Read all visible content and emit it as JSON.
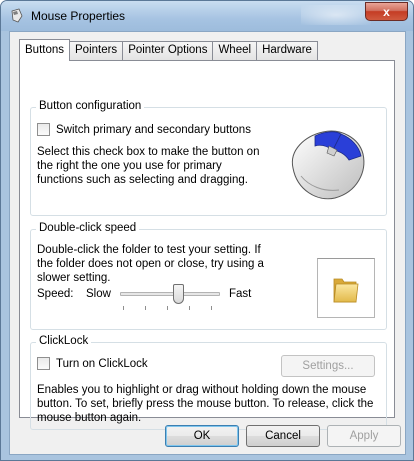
{
  "window": {
    "title": "Mouse Properties",
    "title_icon": "mouse-icon",
    "close_glyph": "x"
  },
  "tabs": [
    {
      "label": "Buttons",
      "active": true
    },
    {
      "label": "Pointers",
      "active": false
    },
    {
      "label": "Pointer Options",
      "active": false
    },
    {
      "label": "Wheel",
      "active": false
    },
    {
      "label": "Hardware",
      "active": false
    }
  ],
  "button_config": {
    "title": "Button configuration",
    "checkbox_label": "Switch primary and secondary buttons",
    "checked": false,
    "description": "Select this check box to make the button on the right the one you use for primary functions such as selecting and dragging.",
    "image_icon": "mouse-image-icon"
  },
  "double_click": {
    "title": "Double-click speed",
    "description": "Double-click the folder to test your setting. If the folder does not open or close, try using a slower setting.",
    "speed_label": "Speed:",
    "slow_label": "Slow",
    "fast_label": "Fast",
    "slider_value_fraction": 0.55,
    "folder_icon": "folder-icon"
  },
  "clicklock": {
    "title": "ClickLock",
    "checkbox_label": "Turn on ClickLock",
    "checked": false,
    "settings_label": "Settings...",
    "description": "Enables you to highlight or drag without holding down the mouse button. To set, briefly press the mouse button. To release, click the mouse button again."
  },
  "footer": {
    "ok_label": "OK",
    "cancel_label": "Cancel",
    "apply_label": "Apply"
  },
  "colors": {
    "accent_blue": "#3c7fb1",
    "close_red": "#c43c24"
  }
}
